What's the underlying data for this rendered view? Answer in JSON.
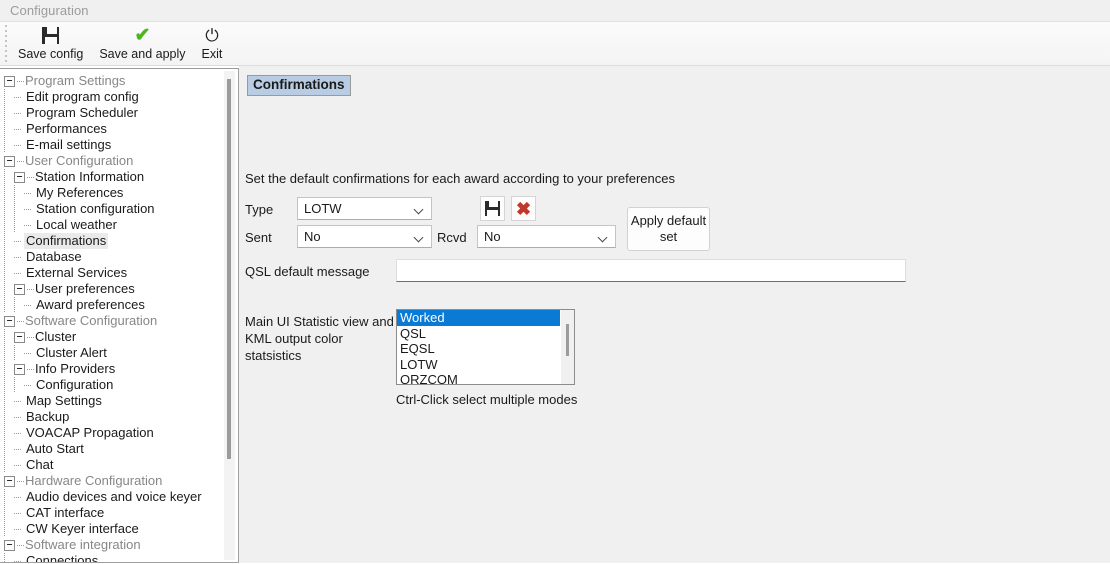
{
  "window": {
    "title": "Configuration"
  },
  "toolbar": {
    "buttons": [
      {
        "label": "Save config",
        "icon": "floppy-disk-icon"
      },
      {
        "label": "Save and apply",
        "icon": "green-check-icon"
      },
      {
        "label": "Exit",
        "icon": "power-icon"
      }
    ]
  },
  "tree": {
    "nodes": [
      {
        "label": "Program Settings",
        "level": 0,
        "expander": true,
        "selected": false
      },
      {
        "label": "Edit program config",
        "level": 1,
        "expander": false,
        "selected": false
      },
      {
        "label": "Program Scheduler",
        "level": 1,
        "expander": false,
        "selected": false
      },
      {
        "label": "Performances",
        "level": 1,
        "expander": false,
        "selected": false
      },
      {
        "label": "E-mail settings",
        "level": 1,
        "expander": false,
        "selected": false
      },
      {
        "label": "User Configuration",
        "level": 0,
        "expander": true,
        "selected": false
      },
      {
        "label": "Station Information",
        "level": 1,
        "expander": true,
        "selected": false
      },
      {
        "label": "My References",
        "level": 2,
        "expander": false,
        "selected": false
      },
      {
        "label": "Station configuration",
        "level": 2,
        "expander": false,
        "selected": false
      },
      {
        "label": "Local weather",
        "level": 2,
        "expander": false,
        "selected": false
      },
      {
        "label": "Confirmations",
        "level": 1,
        "expander": false,
        "selected": true
      },
      {
        "label": "Database",
        "level": 1,
        "expander": false,
        "selected": false
      },
      {
        "label": "External Services",
        "level": 1,
        "expander": false,
        "selected": false
      },
      {
        "label": "User preferences",
        "level": 1,
        "expander": true,
        "selected": false
      },
      {
        "label": "Award preferences",
        "level": 2,
        "expander": false,
        "selected": false
      },
      {
        "label": "Software Configuration",
        "level": 0,
        "expander": true,
        "selected": false
      },
      {
        "label": "Cluster",
        "level": 1,
        "expander": true,
        "selected": false
      },
      {
        "label": "Cluster Alert",
        "level": 2,
        "expander": false,
        "selected": false
      },
      {
        "label": "Info Providers",
        "level": 1,
        "expander": true,
        "selected": false
      },
      {
        "label": "Configuration",
        "level": 2,
        "expander": false,
        "selected": false
      },
      {
        "label": "Map Settings",
        "level": 1,
        "expander": false,
        "selected": false
      },
      {
        "label": "Backup",
        "level": 1,
        "expander": false,
        "selected": false
      },
      {
        "label": "VOACAP Propagation",
        "level": 1,
        "expander": false,
        "selected": false
      },
      {
        "label": "Auto Start",
        "level": 1,
        "expander": false,
        "selected": false
      },
      {
        "label": "Chat",
        "level": 1,
        "expander": false,
        "selected": false
      },
      {
        "label": "Hardware Configuration",
        "level": 0,
        "expander": true,
        "selected": false
      },
      {
        "label": "Audio devices and voice keyer",
        "level": 1,
        "expander": false,
        "selected": false
      },
      {
        "label": "CAT interface",
        "level": 1,
        "expander": false,
        "selected": false
      },
      {
        "label": "CW Keyer interface",
        "level": 1,
        "expander": false,
        "selected": false
      },
      {
        "label": "Software integration",
        "level": 0,
        "expander": true,
        "selected": false
      },
      {
        "label": "Connections",
        "level": 1,
        "expander": false,
        "selected": false
      }
    ]
  },
  "panel": {
    "section_title": "Confirmations",
    "description": "Set the default confirmations for each award according to your preferences",
    "type_label": "Type",
    "type_value": "LOTW",
    "sent_label": "Sent",
    "sent_value": "No",
    "rcvd_label": "Rcvd",
    "rcvd_value": "No",
    "save_icon": "floppy-disk-icon",
    "delete_icon": "red-x-icon",
    "apply_default_label": "Apply default set",
    "qsl_message_label": "QSL default message",
    "qsl_message_value": "",
    "statistics_label": "Main UI Statistic view and KML output color statsistics",
    "statistics_items": [
      "Worked",
      "QSL",
      "EQSL",
      "LOTW",
      "QRZCOM"
    ],
    "statistics_selected": "Worked",
    "hint": "Ctrl-Click select multiple modes"
  },
  "colors": {
    "selection_blue": "#0b7ad5",
    "section_header_bg": "#b8cce4",
    "check_green": "#4cb520",
    "delete_red": "#c0392b"
  }
}
